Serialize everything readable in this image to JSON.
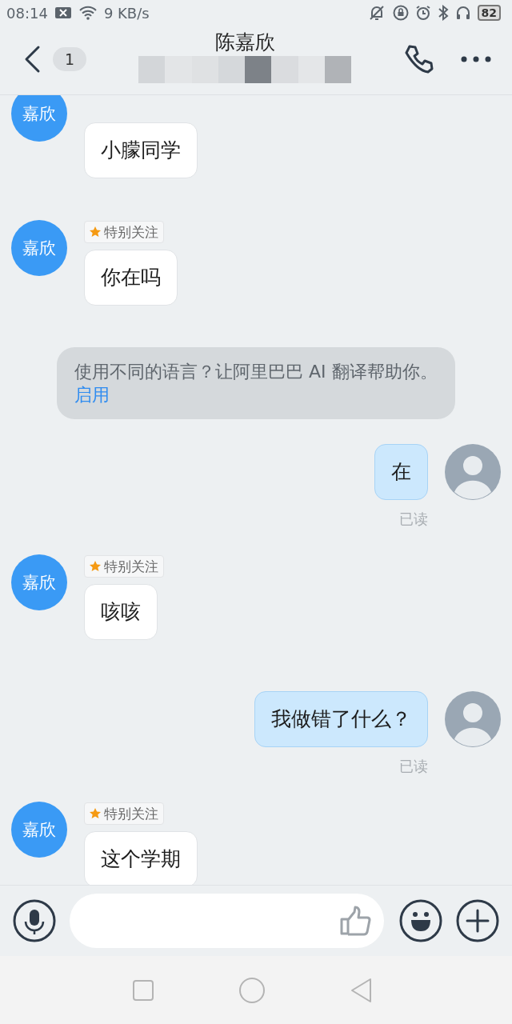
{
  "status_bar": {
    "time": "08:14",
    "speed": "9 KB/s",
    "battery": "82"
  },
  "header": {
    "unread_badge": "1",
    "title": "陈嘉欣"
  },
  "messages": [
    {
      "kind": "incoming",
      "avatar": "嘉欣",
      "text": "小朦同学"
    },
    {
      "kind": "incoming",
      "avatar": "嘉欣",
      "tag": "特别关注",
      "text": "你在吗"
    },
    {
      "kind": "system",
      "text": "使用不同的语言？让阿里巴巴 AI 翻译帮助你。",
      "link": "启用"
    },
    {
      "kind": "outgoing",
      "text": "在",
      "status": "已读"
    },
    {
      "kind": "incoming",
      "avatar": "嘉欣",
      "tag": "特别关注",
      "text": "咳咳"
    },
    {
      "kind": "outgoing",
      "text": "我做错了什么？",
      "status": "已读"
    },
    {
      "kind": "incoming",
      "avatar": "嘉欣",
      "tag": "特别关注",
      "text": "这个学期"
    }
  ]
}
